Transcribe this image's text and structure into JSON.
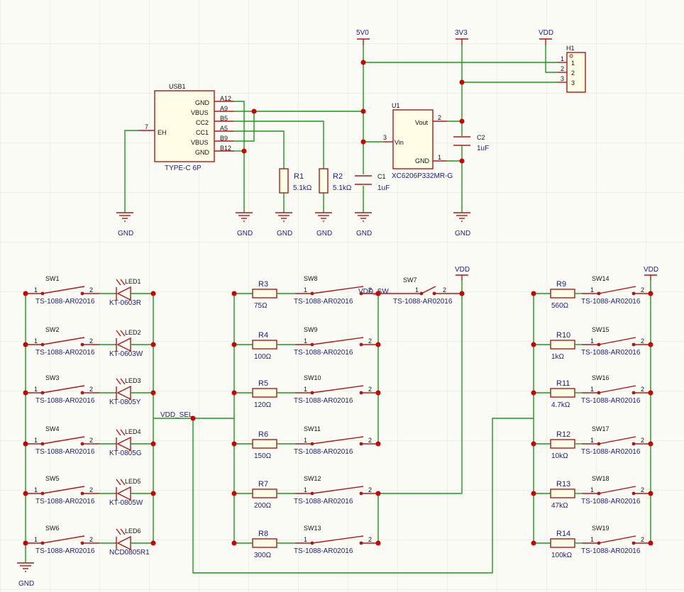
{
  "power": {
    "v5": "5V0",
    "v33": "3V3",
    "vdd": "VDD",
    "gnd": "GND"
  },
  "nets": {
    "vdd_sw": "VDD_SW",
    "vdd_sel": "VDD_SEL"
  },
  "usb": {
    "ref": "USB1",
    "value": "TYPE-C 6P",
    "eh_pin": "7",
    "eh_label": "EH",
    "pins": [
      {
        "name": "GND",
        "num": "A12"
      },
      {
        "name": "VBUS",
        "num": "A9"
      },
      {
        "name": "CC2",
        "num": "B5"
      },
      {
        "name": "CC1",
        "num": "A5"
      },
      {
        "name": "VBUS",
        "num": "B9"
      },
      {
        "name": "GND",
        "num": "B12"
      }
    ]
  },
  "u1": {
    "ref": "U1",
    "value": "XC6206P332MR-G",
    "vin": "Vin",
    "vout": "Vout",
    "gnd": "GND",
    "pin_vin": "3",
    "pin_vout": "2",
    "pin_gnd": "1"
  },
  "h1": {
    "ref": "H1",
    "pins": [
      "1",
      "2",
      "3"
    ]
  },
  "passives": [
    {
      "ref": "R1",
      "value": "5.1kΩ"
    },
    {
      "ref": "R2",
      "value": "5.1kΩ"
    },
    {
      "ref": "C1",
      "value": "1uF"
    },
    {
      "ref": "C2",
      "value": "1uF"
    }
  ],
  "switch_part": "TS-1088-AR02016",
  "pin1": "1",
  "pin2": "2",
  "left_rows": [
    {
      "sw": "SW1",
      "led": "LED1",
      "led_val": "KT-0603R"
    },
    {
      "sw": "SW2",
      "led": "LED2",
      "led_val": "KT-0603W"
    },
    {
      "sw": "SW3",
      "led": "LED3",
      "led_val": "KT-0805Y"
    },
    {
      "sw": "SW4",
      "led": "LED4",
      "led_val": "KT-0805G"
    },
    {
      "sw": "SW5",
      "led": "LED5",
      "led_val": "KT-0805W"
    },
    {
      "sw": "SW6",
      "led": "LED6",
      "led_val": "NCD0805R1"
    }
  ],
  "mid_rows": [
    {
      "r": "R3",
      "val": "75Ω",
      "sw": "SW8"
    },
    {
      "r": "R4",
      "val": "100Ω",
      "sw": "SW9"
    },
    {
      "r": "R5",
      "val": "120Ω",
      "sw": "SW10"
    },
    {
      "r": "R6",
      "val": "150Ω",
      "sw": "SW11"
    },
    {
      "r": "R7",
      "val": "200Ω",
      "sw": "SW12"
    },
    {
      "r": "R8",
      "val": "300Ω",
      "sw": "SW13"
    }
  ],
  "sw7": "SW7",
  "right_rows": [
    {
      "r": "R9",
      "val": "560Ω",
      "sw": "SW14"
    },
    {
      "r": "R10",
      "val": "1kΩ",
      "sw": "SW15"
    },
    {
      "r": "R11",
      "val": "4.7kΩ",
      "sw": "SW16"
    },
    {
      "r": "R12",
      "val": "10kΩ",
      "sw": "SW17"
    },
    {
      "r": "R13",
      "val": "47kΩ",
      "sw": "SW18"
    },
    {
      "r": "R14",
      "val": "100kΩ",
      "sw": "SW19"
    }
  ]
}
